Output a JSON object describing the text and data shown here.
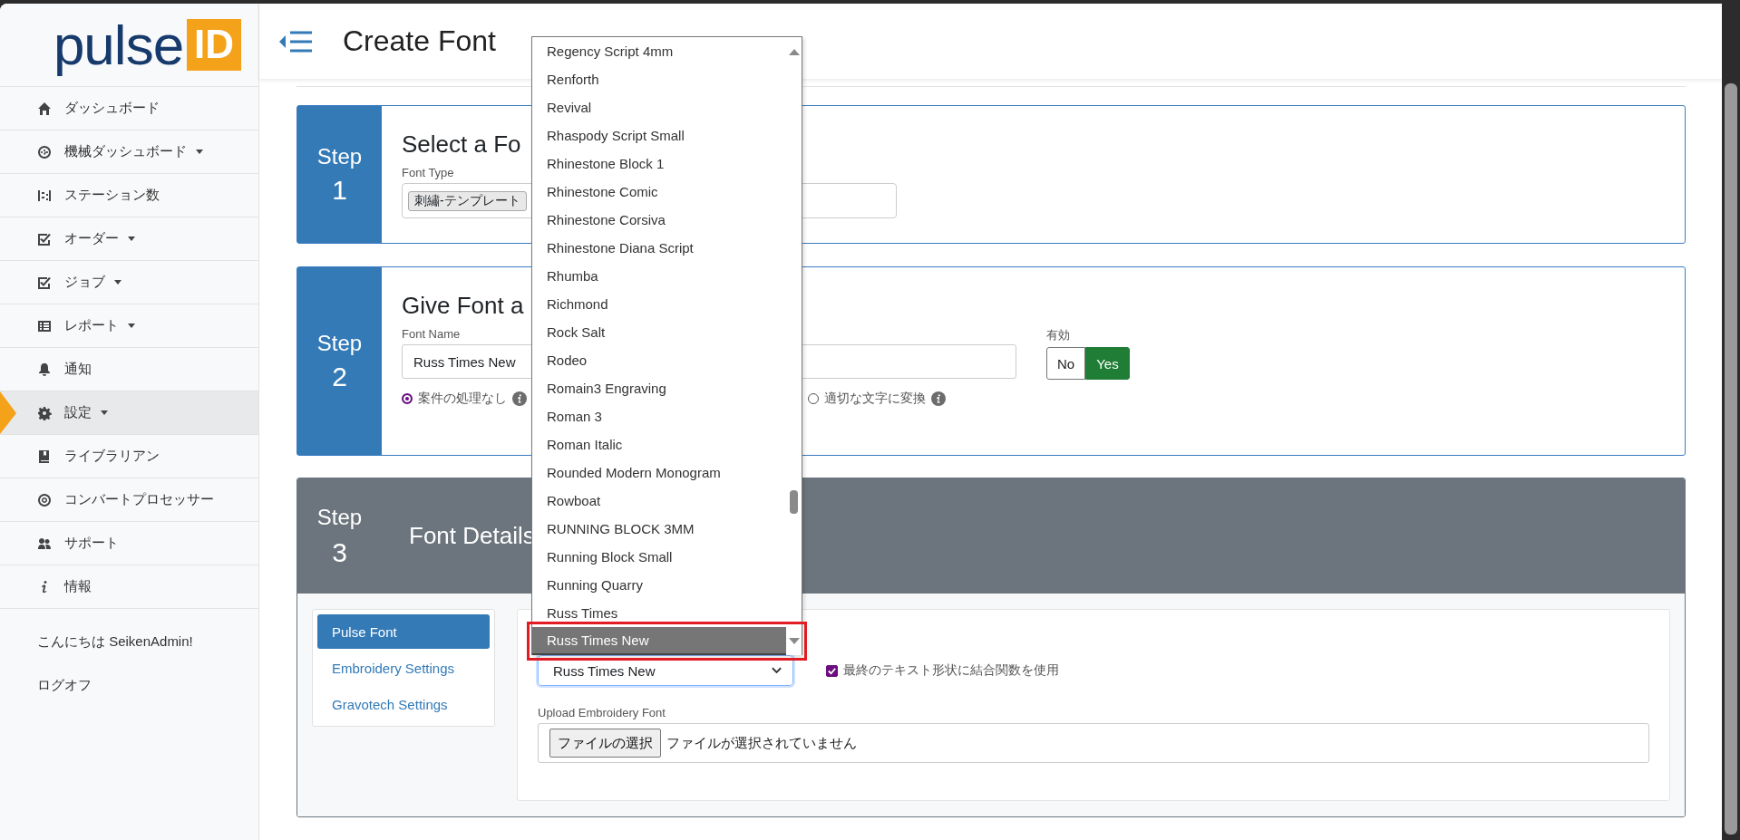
{
  "logo": {
    "text": "pulse",
    "badge": "ID"
  },
  "sidebar": {
    "items": [
      {
        "label": "ダッシュボード",
        "caret": false,
        "selected": false
      },
      {
        "label": "機械ダッシュボード",
        "caret": true,
        "selected": false
      },
      {
        "label": "ステーション数",
        "caret": false,
        "selected": false
      },
      {
        "label": "オーダー",
        "caret": true,
        "selected": false
      },
      {
        "label": "ジョブ",
        "caret": true,
        "selected": false
      },
      {
        "label": "レポート",
        "caret": true,
        "selected": false
      },
      {
        "label": "通知",
        "caret": false,
        "selected": false
      },
      {
        "label": "設定",
        "caret": true,
        "selected": true
      },
      {
        "label": "ライブラリアン",
        "caret": false,
        "selected": false
      },
      {
        "label": "コンバートプロセッサー",
        "caret": false,
        "selected": false
      },
      {
        "label": "サポート",
        "caret": false,
        "selected": false
      },
      {
        "label": "情報",
        "caret": false,
        "selected": false
      }
    ],
    "greeting": "こんにちは SeikenAdmin!",
    "logout": "ログオフ"
  },
  "header": {
    "title": "Create Font"
  },
  "step1": {
    "label": "Step",
    "number": "1",
    "title": "Select a Fo",
    "field_label": "Font Type",
    "tag": "刺繡-テンプレート"
  },
  "step2": {
    "label": "Step",
    "number": "2",
    "title": "Give Font a",
    "field_label": "Font Name",
    "value": "Russ Times New",
    "radios": [
      {
        "label": "案件の処理なし",
        "selected": true
      },
      {
        "label": "適切な文字に変換",
        "selected": false
      }
    ],
    "enabled": {
      "label": "有効",
      "options": [
        {
          "label": "No",
          "selected": false
        },
        {
          "label": "Yes",
          "selected": true
        }
      ]
    }
  },
  "step3": {
    "label": "Step",
    "number": "3",
    "title": "Font Details",
    "tabs": [
      {
        "label": "Pulse Font",
        "selected": true
      },
      {
        "label": "Embroidery Settings",
        "selected": false
      },
      {
        "label": "Gravotech Settings",
        "selected": false
      }
    ],
    "font_select": "Russ Times New",
    "checkbox": {
      "label": "最終のテキスト形状に結合関数を使用",
      "checked": true
    },
    "upload": {
      "label": "Upload Embroidery Font",
      "button": "ファイルの選択",
      "status": "ファイルが選択されていません"
    }
  },
  "dropdown": {
    "options": [
      {
        "label": "Regency Script 4mm",
        "selected": false,
        "highlighted": false
      },
      {
        "label": "Renforth",
        "selected": false,
        "highlighted": false
      },
      {
        "label": "Revival",
        "selected": false,
        "highlighted": false
      },
      {
        "label": "Rhaspody Script Small",
        "selected": false,
        "highlighted": false
      },
      {
        "label": "Rhinestone Block 1",
        "selected": false,
        "highlighted": false
      },
      {
        "label": "Rhinestone Comic",
        "selected": false,
        "highlighted": false
      },
      {
        "label": "Rhinestone Corsiva",
        "selected": false,
        "highlighted": false
      },
      {
        "label": "Rhinestone Diana Script",
        "selected": false,
        "highlighted": false
      },
      {
        "label": "Rhumba",
        "selected": false,
        "highlighted": false
      },
      {
        "label": "Richmond",
        "selected": false,
        "highlighted": false
      },
      {
        "label": "Rock Salt",
        "selected": false,
        "highlighted": false
      },
      {
        "label": "Rodeo",
        "selected": false,
        "highlighted": false
      },
      {
        "label": "Romain3 Engraving",
        "selected": false,
        "highlighted": false
      },
      {
        "label": "Roman 3",
        "selected": false,
        "highlighted": false
      },
      {
        "label": "Roman Italic",
        "selected": false,
        "highlighted": false
      },
      {
        "label": "Rounded Modern Monogram",
        "selected": false,
        "highlighted": false
      },
      {
        "label": "Rowboat",
        "selected": false,
        "highlighted": false
      },
      {
        "label": "RUNNING BLOCK 3MM",
        "selected": false,
        "highlighted": false
      },
      {
        "label": "Running Block Small",
        "selected": false,
        "highlighted": false
      },
      {
        "label": "Running Quarry",
        "selected": false,
        "highlighted": false
      },
      {
        "label": "Russ Times",
        "selected": false,
        "highlighted": false
      },
      {
        "label": "Russ Times New",
        "selected": true,
        "highlighted": true
      }
    ]
  }
}
